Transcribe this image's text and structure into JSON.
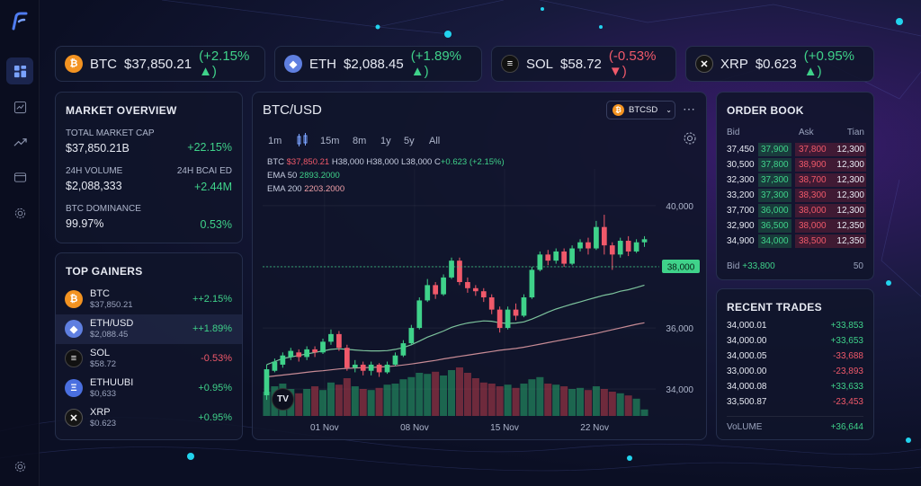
{
  "tickers": [
    {
      "symbol": "BTC",
      "price": "$37,850.21",
      "change": "(+2.15% ▲)",
      "dir": "up"
    },
    {
      "symbol": "ETH",
      "price": "$2,088.45",
      "change": "(+1.89% ▲)",
      "dir": "up"
    },
    {
      "symbol": "SOL",
      "price": "$58.72",
      "change": "(-0.53% ▼)",
      "dir": "down"
    },
    {
      "symbol": "XRP",
      "price": "$0.623",
      "change": "(+0.95% ▲)",
      "dir": "up"
    }
  ],
  "market_overview": {
    "title": "MARKET OVERVIEW",
    "cap_label": "TOTAL MARKET CAP",
    "cap_value": "$37,850.21B",
    "cap_change": "+22.15%",
    "vol_label": "24H VOLUME",
    "vol_value": "$2,088,333",
    "vol_right_label": "24H BCAI ED",
    "vol_change": "+2.44M",
    "dom_label": "BTC DOMINANCE",
    "dom_value": "99.97%",
    "dom_change": "0.53%"
  },
  "top_gainers": {
    "title": "TOP GAINERS",
    "items": [
      {
        "name": "BTC",
        "price": "$37,850.21",
        "change": "++2.15%"
      },
      {
        "name": "ETH/USD",
        "price": "$2,088.45",
        "change": "++1.89%"
      },
      {
        "name": "SOL",
        "price": "$58.72",
        "change": "-0.53%"
      },
      {
        "name": "ETHUUBI",
        "price": "$0,633",
        "change": "+0.95%"
      },
      {
        "name": "XRP",
        "price": "$0.623",
        "change": "+0.95%"
      }
    ]
  },
  "chart": {
    "pair": "BTC/USD",
    "selector": "BTCSD",
    "timeframes": [
      "1m",
      "15m",
      "8m",
      "1y",
      "5y",
      "All"
    ],
    "ohlc": {
      "sym": "BTC",
      "price": "$37,850.21",
      "h_label": "H",
      "h": "38,000",
      "h2_label": "H",
      "h2": "38,000",
      "l_label": "L",
      "l": "38,000",
      "c_label": "C",
      "c": "+0.623 (+2.15%)"
    },
    "ema50_label": "EMA 50",
    "ema50": "2893.2000",
    "ema200_label": "EMA 200",
    "ema200": "2203.2000",
    "price_tag": "38,000",
    "tv_logo": "TV"
  },
  "chart_data": {
    "type": "candlestick",
    "y_ticks": [
      "40,000",
      "38,000",
      "36,000",
      "34,000"
    ],
    "ylim": [
      33300,
      41200
    ],
    "x_ticks": [
      "01 Nov",
      "08 Nov",
      "15 Nov",
      "22 Nov"
    ],
    "current_price": 38000,
    "candles": [
      [
        33800,
        34650,
        33650,
        34800
      ],
      [
        34600,
        34900,
        34550,
        35000
      ],
      [
        34800,
        35100,
        34700,
        35200
      ],
      [
        35050,
        35250,
        34950,
        35350
      ],
      [
        35200,
        35050,
        34900,
        35300
      ],
      [
        35050,
        35300,
        34950,
        35400
      ],
      [
        35300,
        35200,
        35050,
        35400
      ],
      [
        35200,
        35550,
        35150,
        35650
      ],
      [
        35550,
        35800,
        35450,
        35950
      ],
      [
        35800,
        35350,
        35250,
        35900
      ],
      [
        35350,
        34700,
        34600,
        35450
      ],
      [
        34700,
        34800,
        34550,
        34950
      ],
      [
        34800,
        34600,
        34450,
        34900
      ],
      [
        34600,
        34800,
        34450,
        34900
      ],
      [
        34800,
        34550,
        34400,
        34850
      ],
      [
        34550,
        34800,
        34500,
        34900
      ],
      [
        34800,
        35100,
        34750,
        35200
      ],
      [
        35100,
        35500,
        35050,
        35600
      ],
      [
        35500,
        36000,
        35450,
        36100
      ],
      [
        36000,
        36900,
        35950,
        37000
      ],
      [
        36900,
        37400,
        36850,
        37600
      ],
      [
        37400,
        37100,
        36950,
        37500
      ],
      [
        37100,
        37650,
        37050,
        37750
      ],
      [
        37650,
        38200,
        37600,
        38300
      ],
      [
        38200,
        37500,
        37400,
        38300
      ],
      [
        37500,
        37300,
        37150,
        37650
      ],
      [
        37300,
        37200,
        37050,
        37400
      ],
      [
        37200,
        37000,
        36850,
        37300
      ],
      [
        37000,
        36600,
        36450,
        37100
      ],
      [
        36600,
        36000,
        35850,
        36700
      ],
      [
        36000,
        36600,
        35950,
        36700
      ],
      [
        36600,
        36400,
        36250,
        36800
      ],
      [
        36400,
        37000,
        36350,
        37100
      ],
      [
        37000,
        37900,
        36950,
        38000
      ],
      [
        37900,
        38400,
        37850,
        38500
      ],
      [
        38400,
        38200,
        38050,
        38550
      ],
      [
        38200,
        38500,
        38100,
        38600
      ],
      [
        38500,
        38100,
        38000,
        38600
      ],
      [
        38100,
        38600,
        38050,
        38700
      ],
      [
        38600,
        38800,
        38500,
        38900
      ],
      [
        38800,
        38600,
        38400,
        38950
      ],
      [
        38600,
        39300,
        38550,
        39500
      ],
      [
        39300,
        38700,
        38400,
        39700
      ],
      [
        38700,
        38400,
        37900,
        38800
      ],
      [
        38400,
        38850,
        38300,
        38950
      ],
      [
        38850,
        38500,
        38350,
        39000
      ],
      [
        38500,
        38800,
        38450,
        38900
      ],
      [
        38800,
        38900,
        38650,
        39000
      ]
    ],
    "ema50": [
      34800,
      34900,
      35000,
      35050,
      35100,
      35150,
      35200,
      35250,
      35300,
      35320,
      35300,
      35280,
      35260,
      35250,
      35250,
      35260,
      35300,
      35360,
      35450,
      35570,
      35700,
      35800,
      35900,
      36020,
      36100,
      36160,
      36200,
      36230,
      36220,
      36170,
      36150,
      36160,
      36200,
      36290,
      36400,
      36520,
      36620,
      36700,
      36780,
      36850,
      36930,
      37000,
      37070,
      37120,
      37200,
      37250,
      37320,
      37400
    ],
    "ema200": [
      34400,
      34430,
      34460,
      34490,
      34520,
      34550,
      34580,
      34600,
      34630,
      34660,
      34680,
      34690,
      34700,
      34710,
      34720,
      34740,
      34760,
      34790,
      34820,
      34860,
      34900,
      34940,
      34990,
      35030,
      35070,
      35110,
      35150,
      35190,
      35230,
      35270,
      35300,
      35330,
      35370,
      35420,
      35470,
      35520,
      35570,
      35620,
      35670,
      35720,
      35770,
      35820,
      35880,
      35940,
      36000,
      36060,
      36120,
      36170
    ],
    "volume": [
      0.45,
      0.55,
      0.6,
      0.5,
      0.42,
      0.5,
      0.55,
      0.48,
      0.62,
      0.58,
      0.7,
      0.55,
      0.5,
      0.48,
      0.52,
      0.58,
      0.6,
      0.68,
      0.72,
      0.8,
      0.78,
      0.82,
      0.75,
      0.85,
      0.9,
      0.8,
      0.7,
      0.62,
      0.6,
      0.55,
      0.58,
      0.52,
      0.6,
      0.68,
      0.72,
      0.6,
      0.58,
      0.55,
      0.5,
      0.52,
      0.48,
      0.55,
      0.5,
      0.45,
      0.42,
      0.38,
      0.32,
      0.12
    ]
  },
  "order_book": {
    "title": "ORDER BOOK",
    "headers": [
      "Bid",
      "Ask",
      "Tian"
    ],
    "rows": [
      [
        "37,450",
        "37,900",
        "37,800",
        "12,300"
      ],
      [
        "30,500",
        "37,800",
        "38,900",
        "12,300"
      ],
      [
        "32,300",
        "37,300",
        "38,700",
        "12,300"
      ],
      [
        "33,200",
        "37,300",
        "38,300",
        "12,300"
      ],
      [
        "37,700",
        "36,000",
        "38,000",
        "12,300"
      ],
      [
        "32,900",
        "36,500",
        "38,000",
        "12,350"
      ],
      [
        "34,900",
        "34,000",
        "38,500",
        "12,350"
      ]
    ],
    "footer_label": "Bid",
    "footer_value": "+33,800",
    "footer_right": "50"
  },
  "recent_trades": {
    "title": "RECENT TRADES",
    "rows": [
      {
        "price": "34,000.01",
        "change": "+33,853",
        "dir": "up"
      },
      {
        "price": "34,000.00",
        "change": "+33,653",
        "dir": "up"
      },
      {
        "price": "34,000.05",
        "change": "-33,688",
        "dir": "down"
      },
      {
        "price": "33,000.00",
        "change": "-23,893",
        "dir": "down"
      },
      {
        "price": "34,000.08",
        "change": "+33,633",
        "dir": "up"
      },
      {
        "price": "33,500.87",
        "change": "-23,453",
        "dir": "down"
      }
    ],
    "footer_label": "VoLUME",
    "footer_value": "+36,644"
  },
  "colors": {
    "up": "#3fd28a",
    "down": "#f0596a",
    "accent": "#4f7cf0",
    "btc": "#f39321"
  }
}
